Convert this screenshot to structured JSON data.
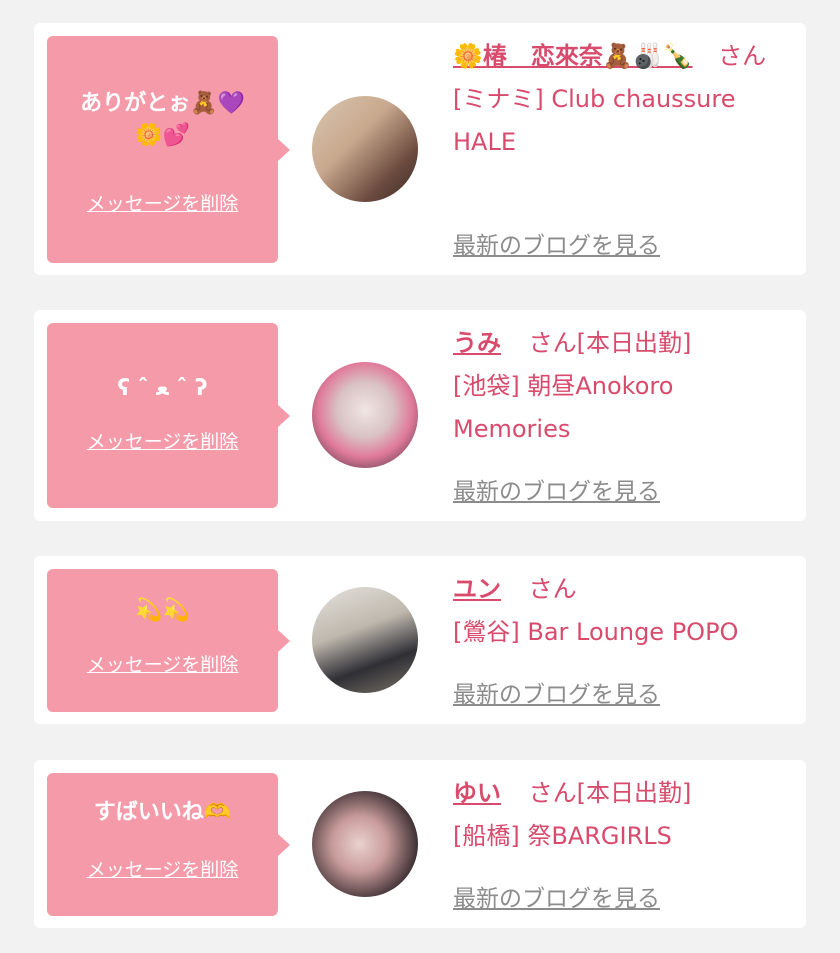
{
  "delete_label": "メッセージを削除",
  "blog_label": "最新のブログを見る",
  "cards": [
    {
      "message": "ありがとぉ🧸💜\n🌼💕",
      "name": "🌼椿　恋來奈🧸🎳🍾",
      "suffix": "さん",
      "shop": "[ミナミ] Club chaussure HALE"
    },
    {
      "message": "ʕ ˆ ﻌ ˆ ʔ",
      "name": "うみ",
      "suffix": "さん[本日出勤]",
      "shop": "[池袋] 朝昼Anokoro Memories"
    },
    {
      "message": "💫💫",
      "name": "ユン",
      "suffix": "さん",
      "shop": "[鶯谷] Bar Lounge POPO"
    },
    {
      "message": "すばいいね🫶",
      "name": "ゆい",
      "suffix": "さん[本日出勤]",
      "shop": "[船橋] 祭BARGIRLS"
    }
  ],
  "colors": {
    "accent": "#d94b6d",
    "bubble": "#f59aa9",
    "link_gray": "#8c8c8c",
    "background": "#f2f2f2"
  }
}
